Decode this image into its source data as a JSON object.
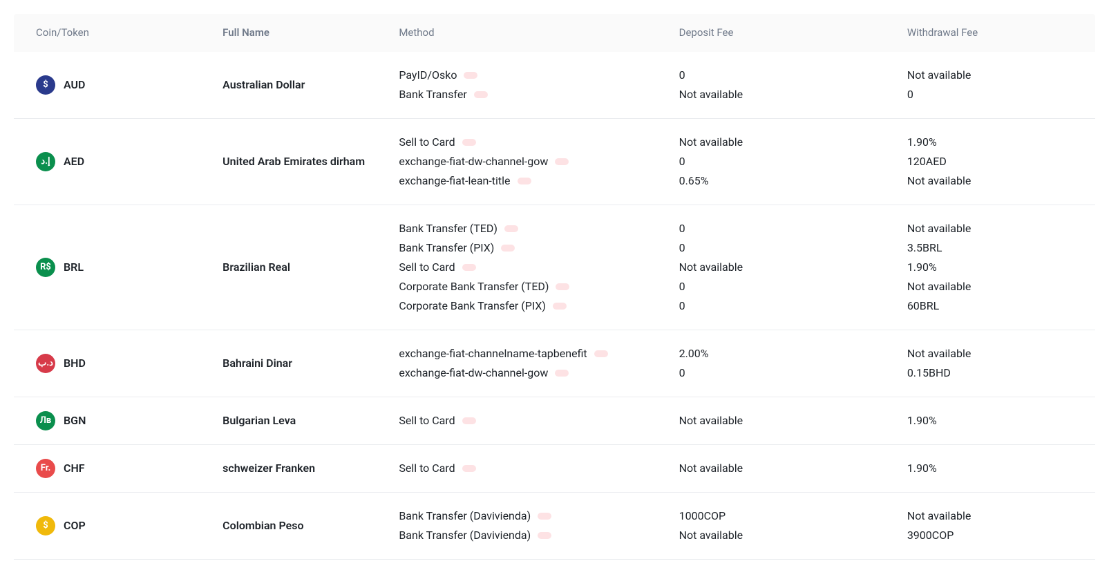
{
  "headers": {
    "coin": "Coin/Token",
    "name": "Full Name",
    "method": "Method",
    "deposit": "Deposit Fee",
    "withdrawal": "Withdrawal Fee"
  },
  "rows": [
    {
      "symbol": "AUD",
      "name": "Australian Dollar",
      "iconBg": "#2a3a8c",
      "iconText": "$",
      "methods": [
        {
          "label": "PayID/Osko",
          "deposit": "0",
          "withdrawal": "Not available"
        },
        {
          "label": "Bank Transfer",
          "deposit": "Not available",
          "withdrawal": "0"
        }
      ]
    },
    {
      "symbol": "AED",
      "name": "United Arab Emirates dirham",
      "iconBg": "#0a8f4d",
      "iconText": "إ.د",
      "methods": [
        {
          "label": "Sell to Card",
          "deposit": "Not available",
          "withdrawal": "1.90%"
        },
        {
          "label": "exchange-fiat-dw-channel-gow",
          "deposit": "0",
          "withdrawal": "120AED"
        },
        {
          "label": "exchange-fiat-lean-title",
          "deposit": "0.65%",
          "withdrawal": "Not available"
        }
      ]
    },
    {
      "symbol": "BRL",
      "name": "Brazilian Real",
      "iconBg": "#0a8f4d",
      "iconText": "R$",
      "methods": [
        {
          "label": "Bank Transfer (TED)",
          "deposit": "0",
          "withdrawal": "Not available"
        },
        {
          "label": "Bank Transfer (PIX)",
          "deposit": "0",
          "withdrawal": "3.5BRL"
        },
        {
          "label": "Sell to Card",
          "deposit": "Not available",
          "withdrawal": "1.90%"
        },
        {
          "label": "Corporate Bank Transfer (TED)",
          "deposit": "0",
          "withdrawal": "Not available"
        },
        {
          "label": "Corporate Bank Transfer (PIX)",
          "deposit": "0",
          "withdrawal": "60BRL"
        }
      ]
    },
    {
      "symbol": "BHD",
      "name": "Bahraini Dinar",
      "iconBg": "#d73a49",
      "iconText": "د.ب",
      "methods": [
        {
          "label": "exchange-fiat-channelname-tapbenefit",
          "deposit": "2.00%",
          "withdrawal": "Not available"
        },
        {
          "label": "exchange-fiat-dw-channel-gow",
          "deposit": "0",
          "withdrawal": "0.15BHD"
        }
      ]
    },
    {
      "symbol": "BGN",
      "name": "Bulgarian Leva",
      "iconBg": "#0a8f4d",
      "iconText": "Лв",
      "methods": [
        {
          "label": "Sell to Card",
          "deposit": "Not available",
          "withdrawal": "1.90%"
        }
      ]
    },
    {
      "symbol": "CHF",
      "name": "schweizer Franken",
      "iconBg": "#e94b4b",
      "iconText": "Fr.",
      "methods": [
        {
          "label": "Sell to Card",
          "deposit": "Not available",
          "withdrawal": "1.90%"
        }
      ]
    },
    {
      "symbol": "COP",
      "name": "Colombian Peso",
      "iconBg": "#f0b90b",
      "iconText": "$",
      "methods": [
        {
          "label": "Bank Transfer (Davivienda)",
          "deposit": "1000COP",
          "withdrawal": "Not available"
        },
        {
          "label": "Bank Transfer (Davivienda)",
          "deposit": "Not available",
          "withdrawal": "3900COP"
        }
      ]
    }
  ]
}
